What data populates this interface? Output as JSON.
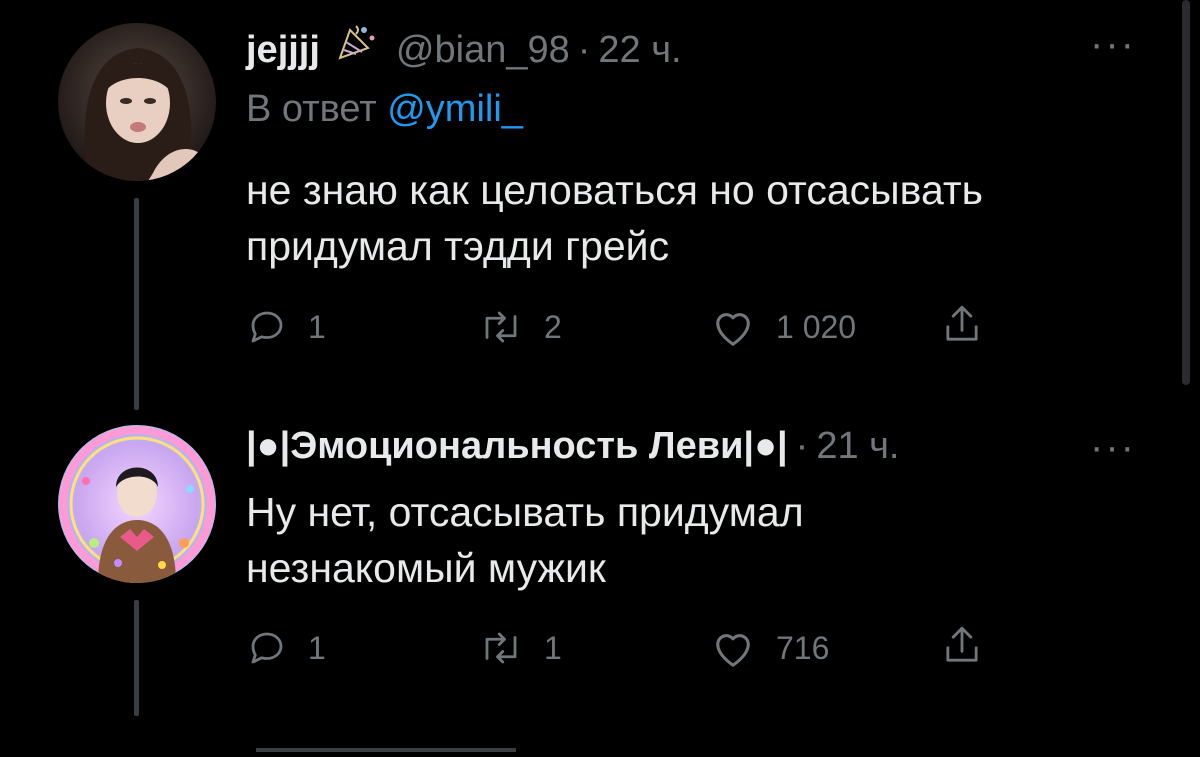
{
  "tweets": [
    {
      "display_name": "jejjjj",
      "handle": "@bian_98",
      "separator": "·",
      "time": "22 ч.",
      "reply_label": "В ответ",
      "reply_mention": "@ymili_",
      "text_lines": [
        "не знаю как целоваться но отсасывать",
        "придумал тэдди грейс"
      ],
      "replies": "1",
      "retweets": "2",
      "likes": "1 020",
      "more": "···"
    },
    {
      "display_name": "|●|Эмоциональность Леви|●|",
      "separator": "·",
      "time": "21 ч.",
      "text_lines": [
        "Ну нет, отсасывать придумал",
        "незнакомый мужик"
      ],
      "replies": "1",
      "retweets": "1",
      "likes": "716",
      "more": "···"
    }
  ],
  "colors": {
    "background": "#000000",
    "text": "#e7e9ea",
    "secondary": "#71767b",
    "mention": "#1d9bf0",
    "thread_line": "#3a3d41"
  },
  "icons": [
    "reply-icon",
    "retweet-icon",
    "like-icon",
    "share-icon",
    "party-popper-emoji",
    "more-icon"
  ]
}
